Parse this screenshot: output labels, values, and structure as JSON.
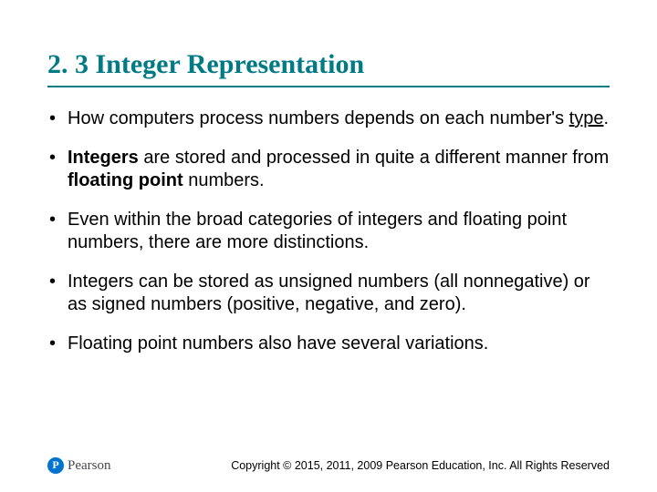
{
  "title": "2. 3 Integer Representation",
  "bullets": [
    {
      "pre": "How computers process numbers depends on each number's ",
      "u1": "type",
      "post1": "."
    },
    {
      "b1": "Integers",
      "mid": " are stored and processed in quite a different manner from ",
      "b2": "floating point",
      "post1": " numbers."
    },
    {
      "pre": "Even within the broad categories of integers and floating point numbers, there are more distinctions."
    },
    {
      "pre": "Integers can be stored as unsigned numbers (all nonnegative) or as signed numbers (positive, negative, and zero)."
    },
    {
      "pre": "Floating point numbers also have several variations."
    }
  ],
  "brand": {
    "name": "Pearson"
  },
  "copyright": "Copyright © 2015, 2011, 2009 Pearson Education, Inc. All Rights Reserved"
}
